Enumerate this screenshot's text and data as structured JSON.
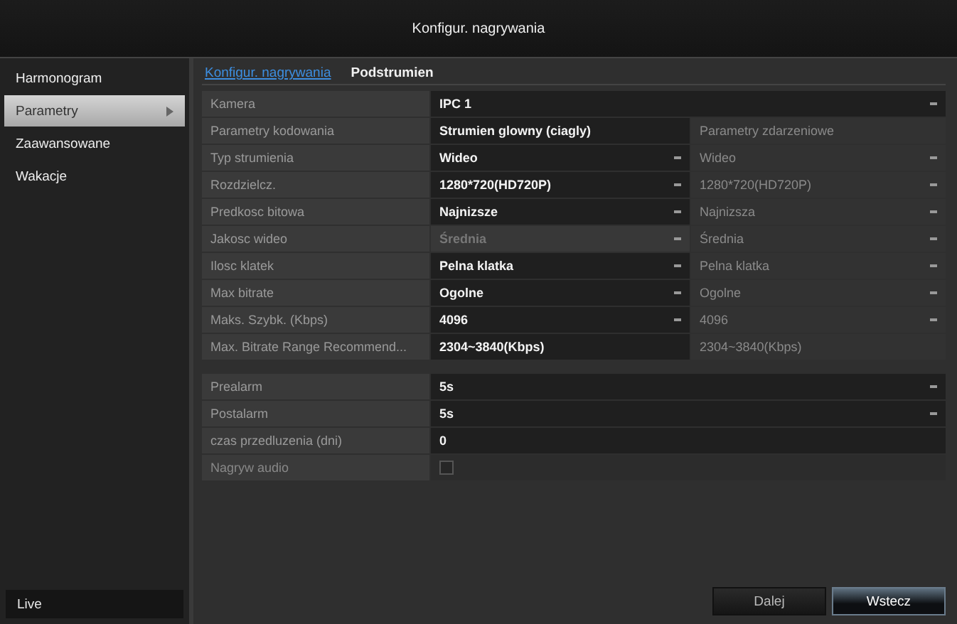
{
  "window": {
    "title": "Konfigur. nagrywania"
  },
  "sidebar": {
    "items": [
      {
        "label": "Harmonogram",
        "selected": false,
        "has_arrow": false
      },
      {
        "label": "Parametry",
        "selected": true,
        "has_arrow": true
      },
      {
        "label": "Zaawansowane",
        "selected": false,
        "has_arrow": false
      },
      {
        "label": "Wakacje",
        "selected": false,
        "has_arrow": false
      }
    ],
    "footer": "Live"
  },
  "tabs": [
    {
      "label": "Konfigur. nagrywania",
      "selected": true
    },
    {
      "label": "Podstrumien",
      "selected": false
    }
  ],
  "camera": {
    "label": "Kamera",
    "value": "IPC 1"
  },
  "rows": [
    {
      "label": "Parametry kodowania",
      "main": {
        "value": "Strumien glowny (ciagly)",
        "kind": "text",
        "disabled": false
      },
      "sub": {
        "value": "Parametry zdarzeniowe",
        "kind": "text"
      }
    },
    {
      "label": "Typ strumienia",
      "main": {
        "value": "Wideo",
        "kind": "select",
        "disabled": false
      },
      "sub": {
        "value": "Wideo",
        "kind": "select"
      }
    },
    {
      "label": "Rozdzielcz.",
      "main": {
        "value": "1280*720(HD720P)",
        "kind": "select",
        "disabled": false
      },
      "sub": {
        "value": "1280*720(HD720P)",
        "kind": "select"
      }
    },
    {
      "label": "Predkosc bitowa",
      "main": {
        "value": "Najnizsze",
        "kind": "select",
        "disabled": false
      },
      "sub": {
        "value": "Najnizsza",
        "kind": "select"
      }
    },
    {
      "label": "Jakosc wideo",
      "main": {
        "value": "Średnia",
        "kind": "select",
        "disabled": true
      },
      "sub": {
        "value": "Średnia",
        "kind": "select"
      }
    },
    {
      "label": "Ilosc klatek",
      "main": {
        "value": "Pelna klatka",
        "kind": "select",
        "disabled": false
      },
      "sub": {
        "value": "Pelna klatka",
        "kind": "select"
      }
    },
    {
      "label": "Max bitrate",
      "main": {
        "value": "Ogolne",
        "kind": "select",
        "disabled": false
      },
      "sub": {
        "value": "Ogolne",
        "kind": "select"
      }
    },
    {
      "label": "Maks. Szybk. (Kbps)",
      "main": {
        "value": "4096",
        "kind": "select",
        "disabled": false
      },
      "sub": {
        "value": "4096",
        "kind": "select"
      }
    },
    {
      "label": "Max. Bitrate Range Recommend...",
      "main": {
        "value": "2304~3840(Kbps)",
        "kind": "text",
        "disabled": false
      },
      "sub": {
        "value": "2304~3840(Kbps)",
        "kind": "text"
      }
    }
  ],
  "alarm_rows": [
    {
      "label": "Prealarm",
      "kind": "select",
      "value": "5s"
    },
    {
      "label": "Postalarm",
      "kind": "select",
      "value": "5s"
    },
    {
      "label": "czas przedluzenia (dni)",
      "kind": "text",
      "value": "0"
    },
    {
      "label": "Nagryw audio",
      "kind": "checkbox",
      "checked": false
    }
  ],
  "buttons": [
    {
      "label": "Dalej",
      "primary": false
    },
    {
      "label": "Wstecz",
      "primary": true
    }
  ]
}
